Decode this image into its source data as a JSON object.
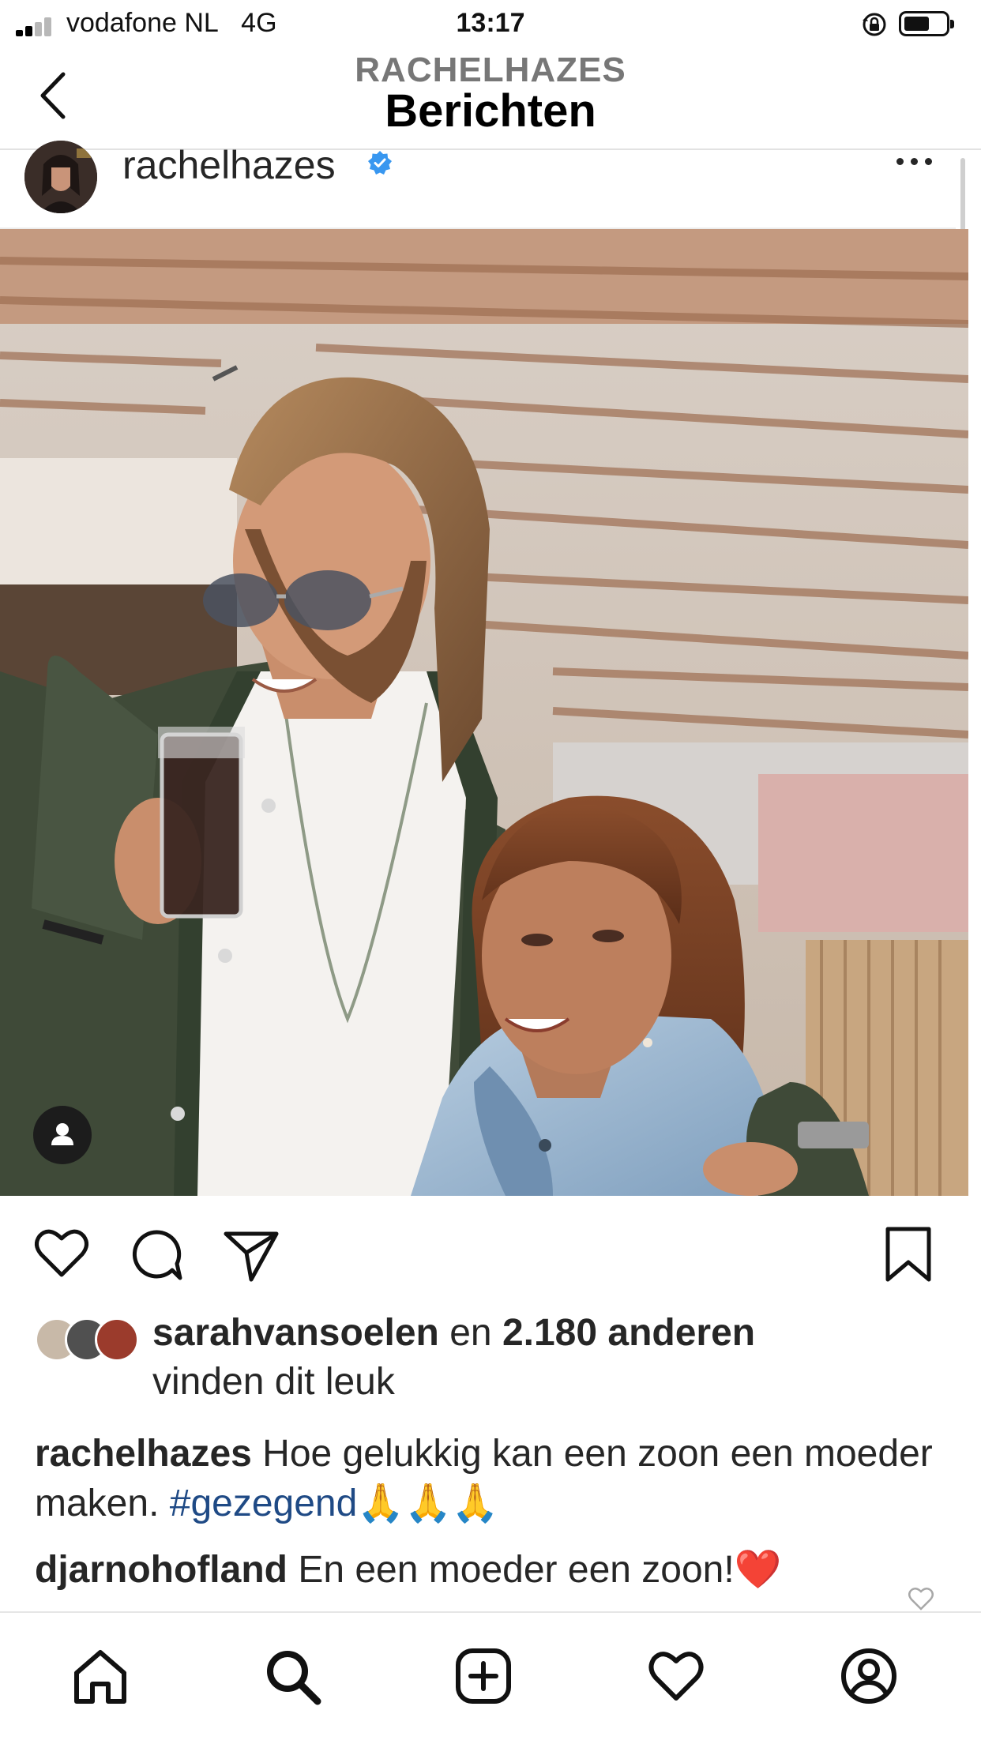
{
  "status_bar": {
    "carrier": "vodafone NL",
    "network": "4G",
    "time": "13:17",
    "battery_level": 0.6
  },
  "nav": {
    "subtitle": "RACHELHAZES",
    "title": "Berichten"
  },
  "post": {
    "username": "rachelhazes",
    "verified": true,
    "accent_color": "#3897f0",
    "likes": {
      "first_liker": "sarahvansoelen",
      "connector": "en",
      "others": "2.180 anderen",
      "line2": "vinden dit leuk"
    },
    "caption": {
      "username": "rachelhazes",
      "text": "Hoe gelukkig kan een zoon een moeder maken.",
      "hashtag": "#gezegend",
      "emoji": "🙏🙏🙏"
    },
    "comment": {
      "username": "djarnohofland",
      "text": "En een moeder een zoon!",
      "emoji": "❤️"
    }
  },
  "icons": {
    "actions": [
      "heart-icon",
      "comment-icon",
      "share-icon",
      "bookmark-icon"
    ],
    "tabs": [
      "home-icon",
      "search-icon",
      "create-icon",
      "activity-heart-icon",
      "profile-icon"
    ]
  }
}
